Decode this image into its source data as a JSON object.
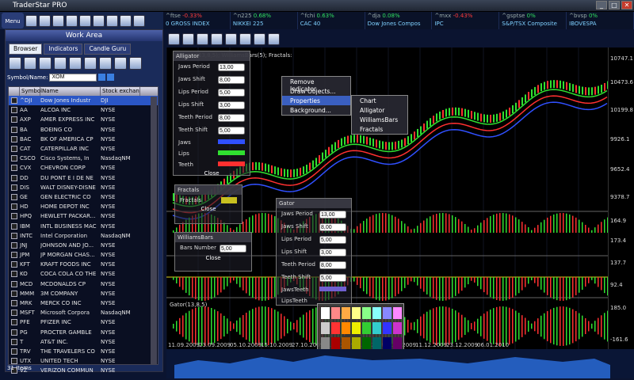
{
  "app": {
    "title": "TraderStar PRO",
    "menu": "Menu"
  },
  "ticker": [
    {
      "sym": "^ftse",
      "chg": "-0.33%",
      "dir": "dn",
      "name": "0 GROSS INDEX"
    },
    {
      "sym": "^n225",
      "chg": "0.68%",
      "dir": "up",
      "name": "NIKKEI 225"
    },
    {
      "sym": "^fchi",
      "chg": "0.63%",
      "dir": "up",
      "name": "CAC 40"
    },
    {
      "sym": "^dja",
      "chg": "0.08%",
      "dir": "up",
      "name": "Dow Jones Compos"
    },
    {
      "sym": "^mxx",
      "chg": "-0.43%",
      "dir": "dn",
      "name": "IPC"
    },
    {
      "sym": "^gsptse",
      "chg": "0%",
      "dir": "up",
      "name": "S&P/TSX Composite"
    },
    {
      "sym": "^bvsp",
      "chg": "0%",
      "dir": "up",
      "name": "IBOVESPA"
    }
  ],
  "panel": {
    "title": "Work Area",
    "tabs": [
      "Browser",
      "Indicators",
      "Candle Guru"
    ],
    "symbol_label": "Symbol/Name:",
    "symbol_value": "XOM",
    "cols": [
      "Symbol",
      "Name",
      "Stock exchan"
    ],
    "status": "31 Items",
    "rows": [
      [
        "^DJI",
        "Dow Jones Industr",
        "DJI"
      ],
      [
        "AA",
        "ALCOA INC",
        "NYSE"
      ],
      [
        "AXP",
        "AMER EXPRESS INC",
        "NYSE"
      ],
      [
        "BA",
        "BOEING CO",
        "NYSE"
      ],
      [
        "BAC",
        "BK OF AMERICA CP",
        "NYSE"
      ],
      [
        "CAT",
        "CATERPILLAR INC",
        "NYSE"
      ],
      [
        "CSCO",
        "Cisco Systems, In",
        "NasdaqNM"
      ],
      [
        "CVX",
        "CHEVRON CORP",
        "NYSE"
      ],
      [
        "DD",
        "DU PONT E I DE NE",
        "NYSE"
      ],
      [
        "DIS",
        "WALT DISNEY-DISNE",
        "NYSE"
      ],
      [
        "GE",
        "GEN ELECTRIC CO",
        "NYSE"
      ],
      [
        "HD",
        "HOME DEPOT INC",
        "NYSE"
      ],
      [
        "HPQ",
        "HEWLETT PACKAR...",
        "NYSE"
      ],
      [
        "IBM",
        "INTL BUSINESS MAC",
        "NYSE"
      ],
      [
        "INTC",
        "Intel Corporation",
        "NasdaqNM"
      ],
      [
        "JNJ",
        "JOHNSON AND JO...",
        "NYSE"
      ],
      [
        "JPM",
        "JP MORGAN CHAS...",
        "NYSE"
      ],
      [
        "KFT",
        "KRAFT FOODS INC",
        "NYSE"
      ],
      [
        "KO",
        "COCA COLA CO THE",
        "NYSE"
      ],
      [
        "MCD",
        "MCDONALDS CP",
        "NYSE"
      ],
      [
        "MMM",
        "3M COMPANY",
        "NYSE"
      ],
      [
        "MRK",
        "MERCK CO INC",
        "NYSE"
      ],
      [
        "MSFT",
        "Microsoft Corpora",
        "NasdaqNM"
      ],
      [
        "PFE",
        "PFIZER INC",
        "NYSE"
      ],
      [
        "PG",
        "PROCTER  GAMBLE",
        "NYSE"
      ],
      [
        "T",
        "AT&T INC.",
        "NYSE"
      ],
      [
        "TRV",
        "THE TRAVELERS CO",
        "NYSE"
      ],
      [
        "UTX",
        "UNITED TECH",
        "NYSE"
      ],
      [
        "VZ",
        "VERIZON COMMUN",
        "NYSE"
      ]
    ]
  },
  "chart": {
    "header": "Alligator(13,8,5); WilliamsBars(5); Fractals:",
    "gator": "Gator(13,8,5)",
    "ylabels": [
      "10747.1",
      "10473.6",
      "10199.8",
      "9926.1",
      "9652.4",
      "9378.7",
      "164.9",
      "173.4",
      "137.7",
      "92.4",
      "185.0",
      "-161.6"
    ],
    "xlabels": [
      "11.09.2009",
      "23.09.2009",
      "05.10.2009",
      "15.10.2009",
      "27.10.2009",
      "06.11.2009",
      "18.11.2009",
      "30.11.2009",
      "11.12.2009",
      "23.12.2009",
      "06.01.2010"
    ]
  },
  "context_menu": [
    "Remove Indicator...",
    "Draw Objects...",
    "Properties",
    "Background..."
  ],
  "submenu": [
    "Chart",
    "Alligator",
    "WilliamsBars",
    "Fractals"
  ],
  "alligator_dlg": {
    "title": "Alligator",
    "fields": [
      [
        "Jaws Period",
        "13,00"
      ],
      [
        "Jaws Shift",
        "8,00"
      ],
      [
        "Lips Period",
        "5,00"
      ],
      [
        "Lips Shift",
        "3,00"
      ],
      [
        "Teeth Period",
        "8,00"
      ],
      [
        "Teeth Shift",
        "5,00"
      ]
    ],
    "labels": [
      "Jaws",
      "Lips",
      "Teeth"
    ],
    "close": "Close"
  },
  "fractals_dlg": {
    "title": "Fractals",
    "label": "Fractals",
    "close": "Close"
  },
  "wb_dlg": {
    "title": "WilliamsBars",
    "label": "Bars Number",
    "value": "5,00",
    "close": "Close"
  },
  "gator_dlg": {
    "title": "Gator",
    "fields": [
      [
        "Jaws Period",
        "13,00"
      ],
      [
        "Jaws Shift",
        "8,00"
      ],
      [
        "Lips Period",
        "5,00"
      ],
      [
        "Lips Shift",
        "3,00"
      ],
      [
        "Teeth Period",
        "8,00"
      ],
      [
        "Teeth Shift",
        "5,00"
      ]
    ],
    "labels": [
      "JawsTeeth",
      "LipsTeeth"
    ]
  }
}
